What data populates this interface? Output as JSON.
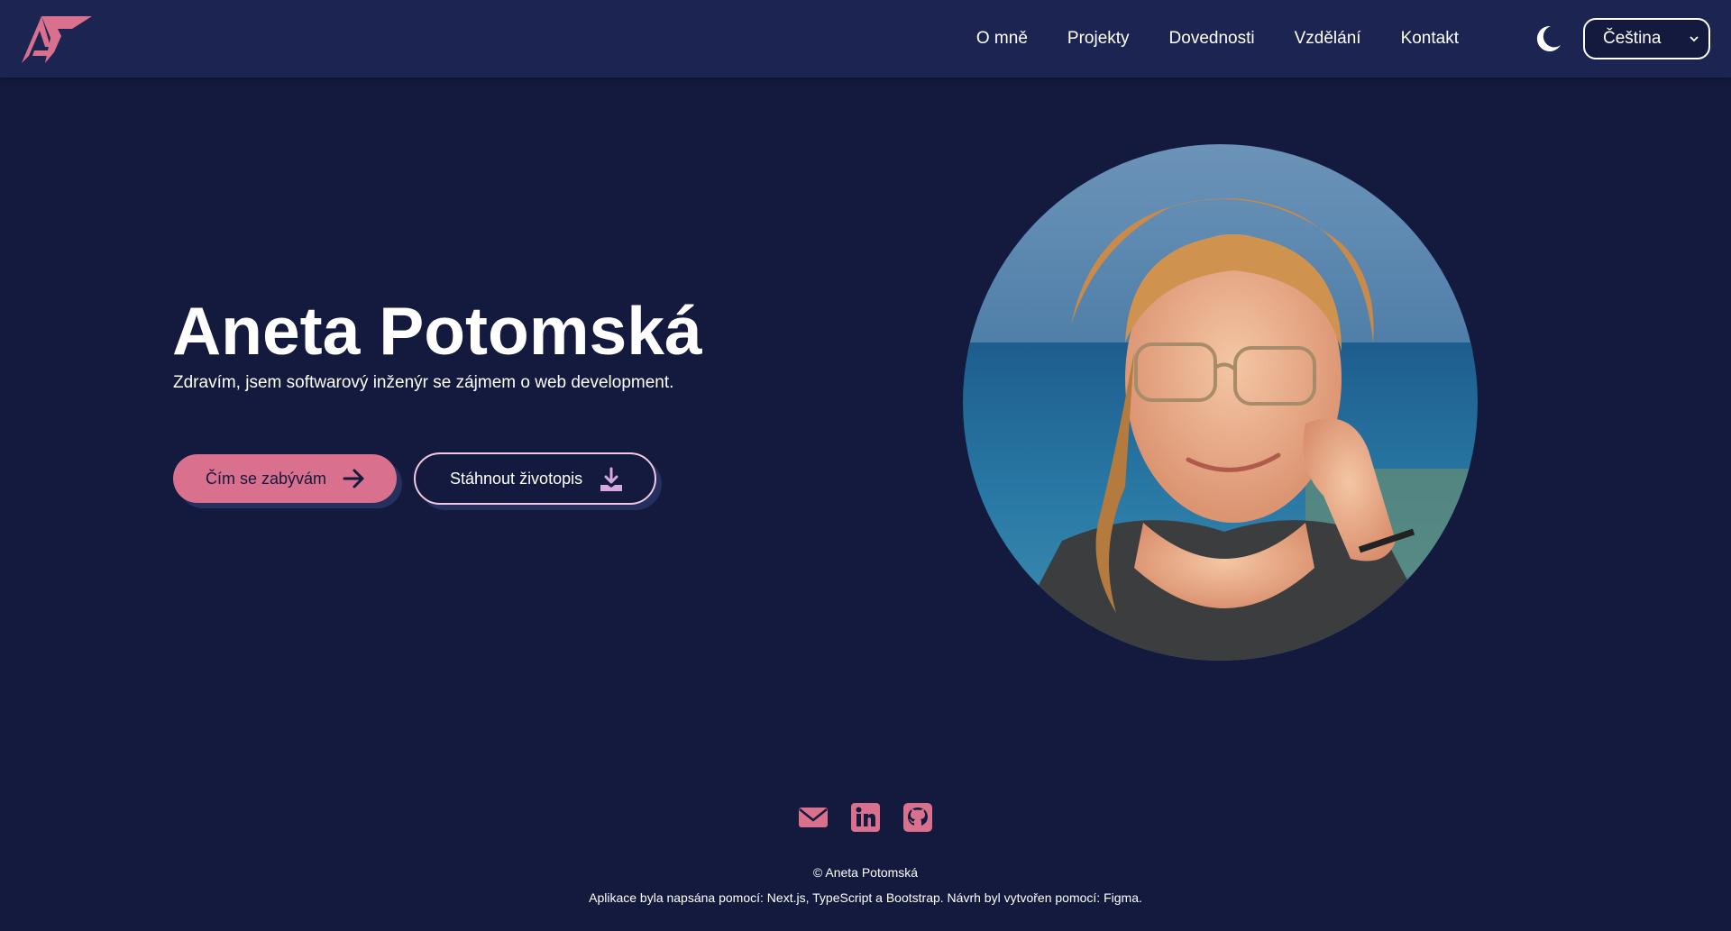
{
  "nav": {
    "links": [
      "O mně",
      "Projekty",
      "Dovednosti",
      "Vzdělání",
      "Kontakt"
    ],
    "theme_icon": "moon-icon",
    "language": "Čeština"
  },
  "hero": {
    "name": "Aneta Potomská",
    "subtitle": "Zdravím, jsem softwarový inženýr se zájmem o web development.",
    "primary_button": "Čím se zabývám",
    "secondary_button": "Stáhnout životopis"
  },
  "socials": [
    "envelope-icon",
    "linkedin-icon",
    "github-icon"
  ],
  "footer": {
    "copyright": "© Aneta Potomská",
    "credits_prefix": "Aplikace byla napsána pomocí: ",
    "tech": [
      "Next.js",
      "TypeScript",
      "Bootstrap"
    ],
    "tech_sep1": ", ",
    "tech_sep2": " a ",
    "design_prefix": ". Návrh byl vytvořen pomocí: ",
    "design_tool": "Figma",
    "end": "."
  },
  "colors": {
    "background": "#131a3e",
    "navbar": "#1c2452",
    "accent": "#d9708e",
    "outline": "#f2c8e4"
  }
}
